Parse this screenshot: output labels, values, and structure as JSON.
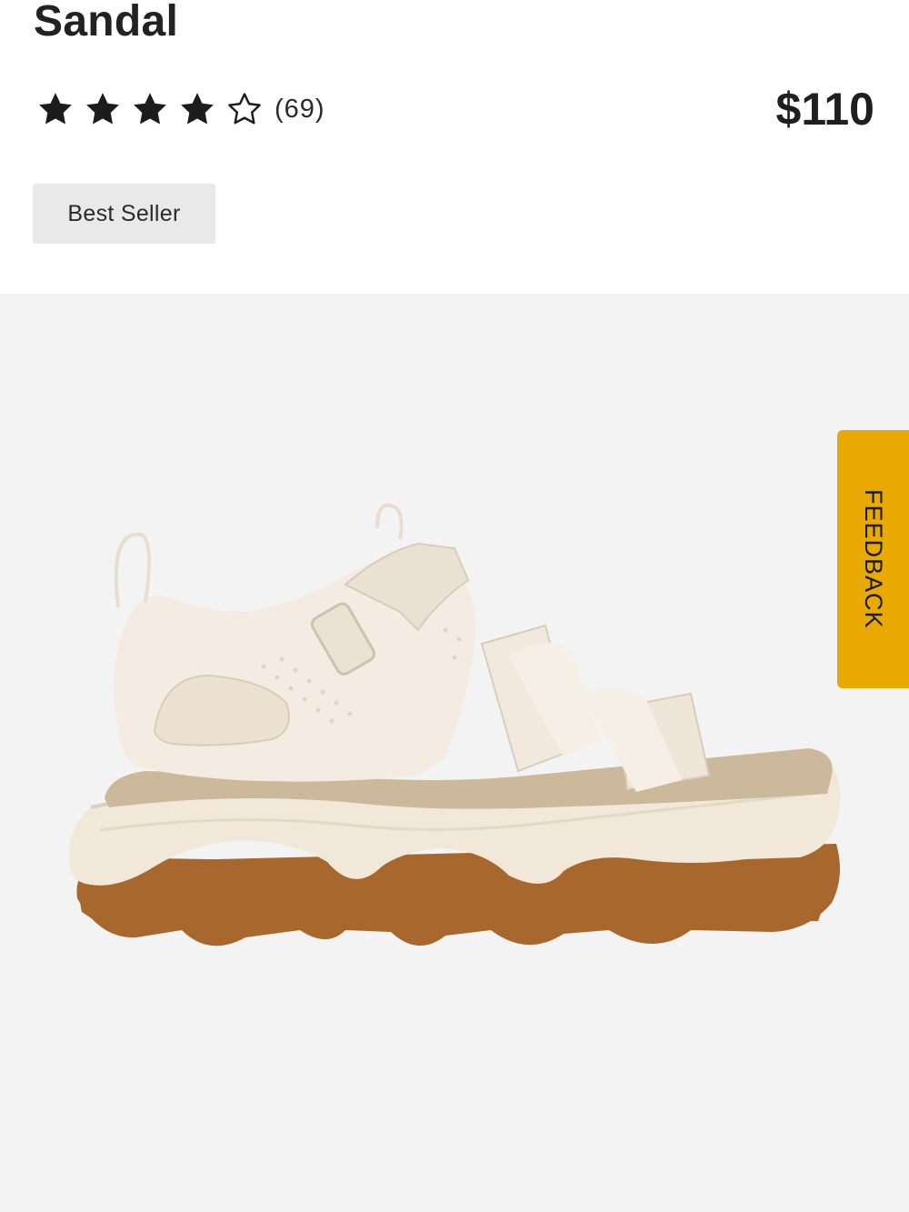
{
  "product": {
    "title": "Sandal",
    "rating_value": 4,
    "rating_max": 5,
    "review_count": "(69)",
    "price": "$110",
    "badge": "Best Seller"
  },
  "feedback": {
    "label": "FEEDBACK"
  },
  "colors": {
    "accent": "#e9a900",
    "gallery_bg": "#f3f3f3",
    "badge_bg": "#e9e9e9"
  },
  "icons": [
    "star-filled-icon",
    "star-outline-icon"
  ]
}
